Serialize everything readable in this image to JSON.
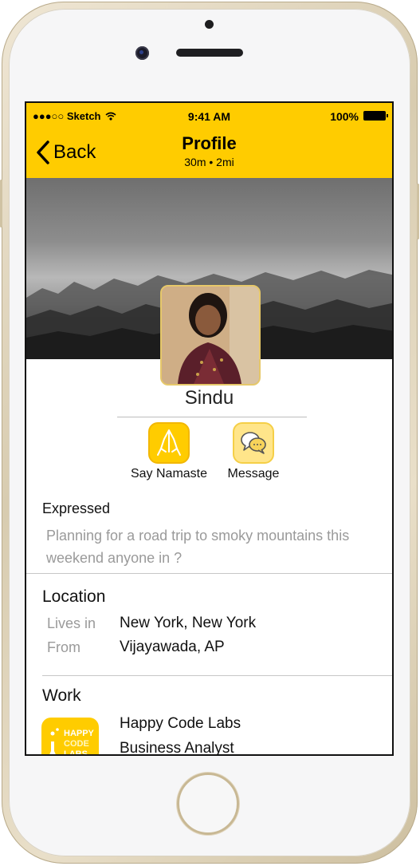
{
  "status_bar": {
    "carrier": "●●●○○ Sketch",
    "time": "9:41 AM",
    "battery": "100%"
  },
  "nav": {
    "back_label": "Back",
    "title": "Profile",
    "subtitle": "30m • 2mi"
  },
  "profile": {
    "name": "Sindu"
  },
  "actions": {
    "namaste_label": "Say Namaste",
    "message_label": "Message"
  },
  "expressed": {
    "title": "Expressed",
    "text": "Planning for a road trip to smoky mountains this weekend anyone in ?"
  },
  "location": {
    "title": "Location",
    "lives_in_label": "Lives in",
    "lives_in_value": "New York, New York",
    "from_label": "From",
    "from_value": "Vijayawada, AP"
  },
  "work": {
    "title": "Work",
    "logo_line1": "HAPPY",
    "logo_line2": "CODE",
    "logo_line3": "LABS",
    "company": "Happy Code Labs",
    "role": "Business Analyst"
  },
  "colors": {
    "accent": "#ffcc00",
    "phone_frame": "#d8ccb0",
    "secondary_text": "#9a9a9a"
  }
}
